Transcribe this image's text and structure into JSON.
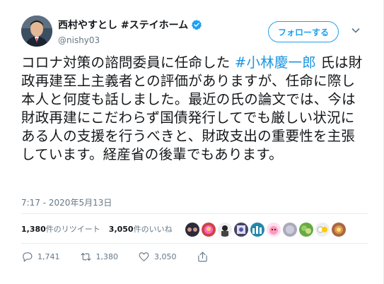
{
  "user": {
    "display_name": "西村やすとし #ステイホーム",
    "handle": "@nishy03"
  },
  "follow_label": "フォローする",
  "tweet": {
    "text_before": "コロナ対策の諮問委員に任命した ",
    "hashtag": "#小林慶一郎",
    "text_after": " 氏は財政再建至上主義者との評価がありますが、任命に際し本人と何度も話しました。最近の氏の論文では、今は財政再建にこだわらず国債発行してでも厳しい状況にある人の支援を行うべきと、財政支出の重要性を主張しています。経産省の後輩でもあります。",
    "timestamp": "7:17 - 2020年5月13日"
  },
  "stats": {
    "retweets_count": "1,380",
    "retweets_label": "件のリツイート",
    "likes_count": "3,050",
    "likes_label": "件のいいね"
  },
  "actions": {
    "reply_count": "1,741",
    "retweet_count": "1,380",
    "like_count": "3,050"
  },
  "colors": {
    "accent": "#1da1f2",
    "hashtag": "#1b95e0",
    "muted": "#657786",
    "border": "#e6ecf0"
  },
  "liker_avatars": [
    "liker-avatar-1",
    "liker-avatar-2",
    "liker-avatar-3",
    "liker-avatar-4",
    "liker-avatar-5",
    "liker-avatar-6",
    "liker-avatar-7",
    "liker-avatar-8",
    "liker-avatar-9",
    "liker-avatar-10"
  ]
}
